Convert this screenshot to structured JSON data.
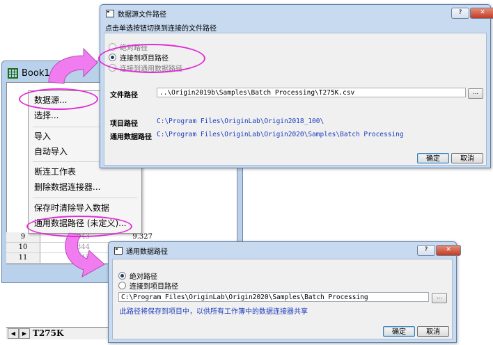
{
  "book": {
    "title": "Book1",
    "rows": [
      {
        "n": "9",
        "a": "843",
        "b": "9.327"
      },
      {
        "n": "10",
        "a": "844",
        "b": ""
      },
      {
        "n": "11",
        "a": "845",
        "b": ""
      }
    ],
    "sheet_tab": "T275K",
    "nav_prev": "◀",
    "nav_next": "▶"
  },
  "context_menu": {
    "items": [
      "数据源...",
      "选择...",
      "导入",
      "自动导入",
      "断连工作表",
      "删除数据连接器...",
      "保存时清除导入数据",
      "通用数据路径 (未定义)..."
    ]
  },
  "dialog1": {
    "title": "数据源文件路径",
    "help": "?",
    "close": "✕",
    "instruction": "点击单选按钮切换到连接的文件路径",
    "radios": [
      "绝对路径",
      "连接到项目路径",
      "连接到通用数据路径"
    ],
    "file_path_label": "文件路径",
    "file_path_value": "..\\Origin2019b\\Samples\\Batch Processing\\T275K.csv",
    "browse": "...",
    "project_path_label": "项目路径",
    "project_path_value": "C:\\Program Files\\OriginLab\\Origin2018_100\\",
    "common_path_label": "通用数据路径",
    "common_path_value": "C:\\Program Files\\OriginLab\\Origin2020\\Samples\\Batch Processing",
    "ok": "确定",
    "cancel": "取消"
  },
  "dialog2": {
    "title": "通用数据路径",
    "help": "?",
    "close": "✕",
    "radios": [
      "绝对路径",
      "连接到项目路径"
    ],
    "path_value": "C:\\Program Files\\OriginLab\\Origin2020\\Samples\\Batch Processing",
    "browse": "...",
    "note": "此路径将保存到项目中，以供所有工作簿中的数据连接器共享",
    "ok": "确定",
    "cancel": "取消"
  },
  "colors": {
    "annotation": "#e12bd6",
    "window_frame": "#c7daf0",
    "link_blue": "#1b3bbd"
  }
}
